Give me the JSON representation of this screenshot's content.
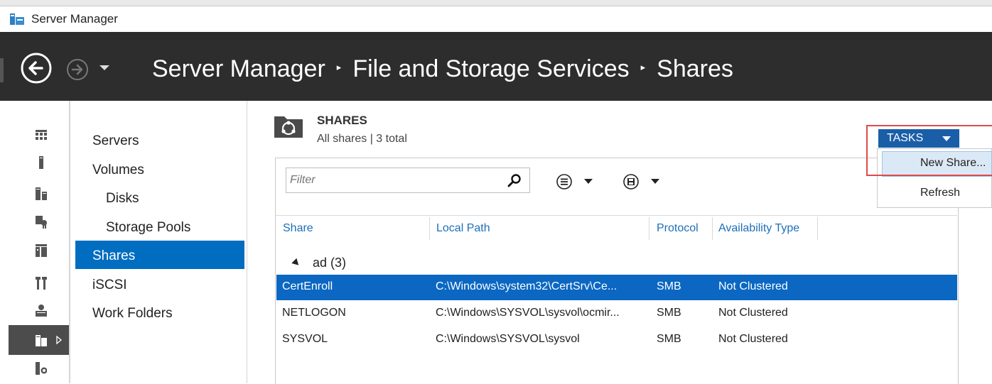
{
  "window": {
    "title": "Server Manager"
  },
  "header": {
    "breadcrumb": [
      "Server Manager",
      "File and Storage Services",
      "Shares"
    ],
    "separator": "▸"
  },
  "nav": {
    "items": [
      {
        "label": "Servers",
        "level": 0
      },
      {
        "label": "Volumes",
        "level": 0
      },
      {
        "label": "Disks",
        "level": 1
      },
      {
        "label": "Storage Pools",
        "level": 1
      },
      {
        "label": "Shares",
        "level": 0,
        "selected": true
      },
      {
        "label": "iSCSI",
        "level": 0
      },
      {
        "label": "Work Folders",
        "level": 0
      }
    ]
  },
  "rail": {
    "icons": [
      "dashboard-icon",
      "local-server-icon",
      "all-servers-icon",
      "ad-cs-icon",
      "ad-ds-icon",
      "dhcp-icon",
      "dns-icon",
      "file-storage-icon",
      "iis-icon"
    ],
    "selected": "file-storage-icon"
  },
  "content": {
    "title": "SHARES",
    "subtitle": "All shares | 3 total",
    "tasks_label": "TASKS",
    "filter_placeholder": "Filter",
    "columns": [
      "Share",
      "Local Path",
      "Protocol",
      "Availability Type"
    ],
    "group": "ad (3)",
    "rows": [
      {
        "share": "CertEnroll",
        "path": "C:\\Windows\\system32\\CertSrv\\Ce...",
        "protocol": "SMB",
        "availability": "Not Clustered",
        "selected": true
      },
      {
        "share": "NETLOGON",
        "path": "C:\\Windows\\SYSVOL\\sysvol\\ocmir...",
        "protocol": "SMB",
        "availability": "Not Clustered",
        "selected": false
      },
      {
        "share": "SYSVOL",
        "path": "C:\\Windows\\SYSVOL\\sysvol",
        "protocol": "SMB",
        "availability": "Not Clustered",
        "selected": false
      }
    ]
  },
  "tasks_menu": {
    "items": [
      "New Share...",
      "Refresh"
    ],
    "highlighted": "New Share..."
  },
  "colors": {
    "header_bg": "#2d2d2d",
    "accent": "#006dc0",
    "selected_row": "#0b67c2",
    "tasks_button": "#1a5ea8",
    "annotation": "#e04a4a"
  }
}
